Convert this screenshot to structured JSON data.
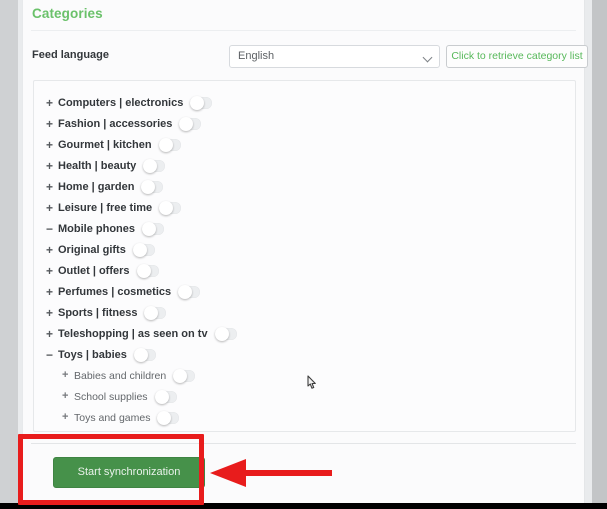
{
  "card": {
    "title": "Categories"
  },
  "feed": {
    "label": "Feed language",
    "language_value": "English",
    "language_options": [
      "English"
    ],
    "retrieve_button": "Click to retrieve category list"
  },
  "categories": [
    {
      "sign": "+",
      "label": "Computers | electronics",
      "toggle": "off",
      "level": 0
    },
    {
      "sign": "+",
      "label": "Fashion | accessories",
      "toggle": "off",
      "level": 0
    },
    {
      "sign": "+",
      "label": "Gourmet | kitchen",
      "toggle": "off",
      "level": 0
    },
    {
      "sign": "+",
      "label": "Health | beauty",
      "toggle": "off",
      "level": 0
    },
    {
      "sign": "+",
      "label": "Home | garden",
      "toggle": "off",
      "level": 0
    },
    {
      "sign": "+",
      "label": "Leisure | free time",
      "toggle": "off",
      "level": 0
    },
    {
      "sign": "−",
      "label": "Mobile phones",
      "toggle": "off",
      "level": 0
    },
    {
      "sign": "+",
      "label": "Original gifts",
      "toggle": "off",
      "level": 0
    },
    {
      "sign": "+",
      "label": "Outlet | offers",
      "toggle": "off",
      "level": 0
    },
    {
      "sign": "+",
      "label": "Perfumes | cosmetics",
      "toggle": "off",
      "level": 0
    },
    {
      "sign": "+",
      "label": "Sports | fitness",
      "toggle": "off",
      "level": 0
    },
    {
      "sign": "+",
      "label": "Teleshopping | as seen on tv",
      "toggle": "off",
      "level": 0
    },
    {
      "sign": "−",
      "label": "Toys | babies",
      "toggle": "off",
      "level": 0
    },
    {
      "sign": "+",
      "label": "Babies and children",
      "toggle": "off",
      "level": 1
    },
    {
      "sign": "+",
      "label": "School supplies",
      "toggle": "off",
      "level": 1
    },
    {
      "sign": "+",
      "label": "Toys and games",
      "toggle": "off",
      "level": 1
    }
  ],
  "footer": {
    "sync_button": "Start synchronization"
  },
  "annotation": {
    "highlight_color": "#e81c1c",
    "arrow_color": "#e81c1c",
    "target": "Start synchronization"
  },
  "colors": {
    "title_green": "#6ac16a",
    "button_green": "#46914a",
    "link_green": "#57b85a",
    "page_bg": "#c3c5c7",
    "card_bg": "#fbfbfc"
  }
}
